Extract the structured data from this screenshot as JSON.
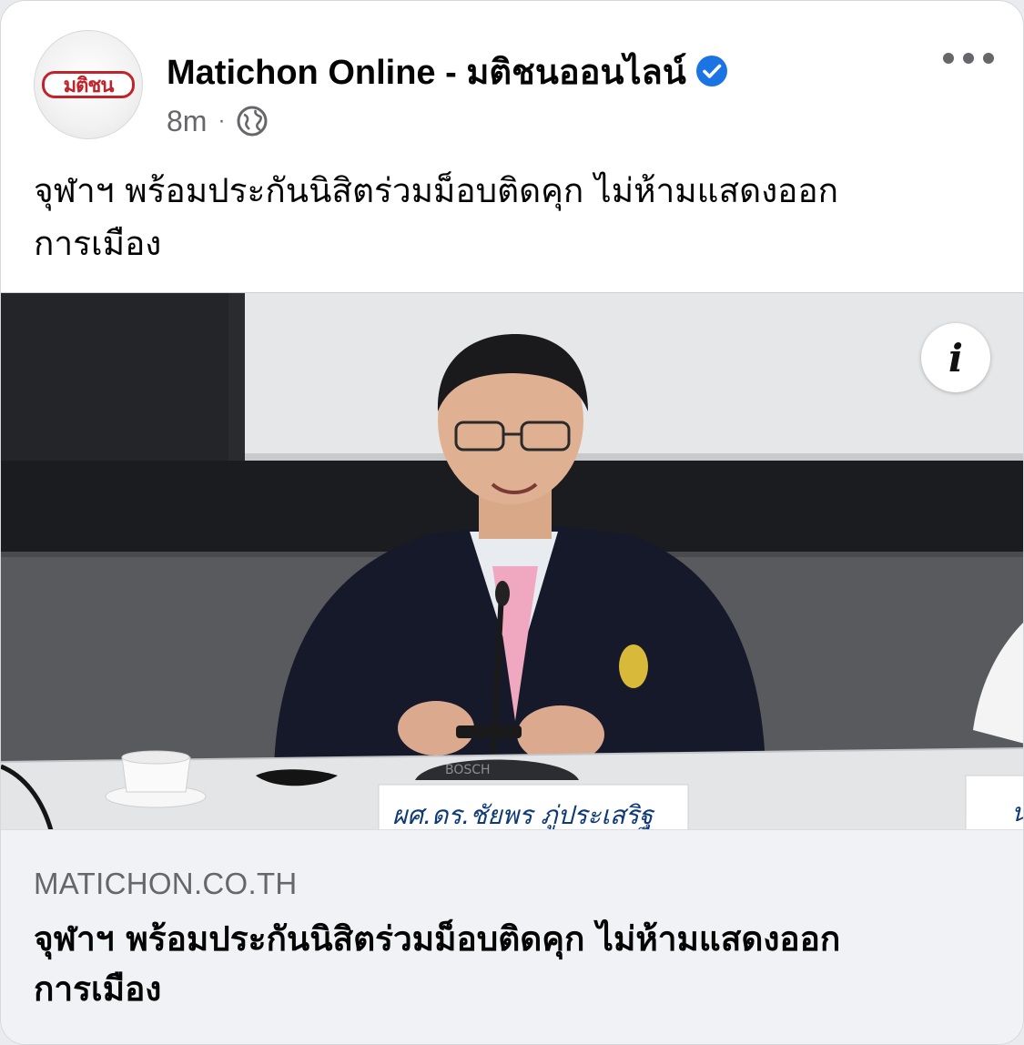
{
  "post": {
    "page_name": "Matichon Online - มติชนออนไลน์",
    "avatar_logo_text": "มติชน",
    "timestamp": "8m",
    "separator": "·",
    "privacy_icon": "globe-icon",
    "verified_icon": "verified-badge-icon",
    "more_icon": "more-options-icon",
    "text_line1": "จุฬาฯ พร้อมประกันนิสิตร่วมม็อบติดคุก ไม่ห้ามแสดงออก",
    "text_line2": "การเมือง"
  },
  "photo": {
    "info_label": "i",
    "mic_brand": "BOSCH",
    "nameplate": "ผศ.ดร.ชัยพร ภู่ประเสริฐ",
    "nameplate_partial": "น"
  },
  "link_preview": {
    "domain": "MATICHON.CO.TH",
    "title_line1": "จุฬาฯ พร้อมประกันนิสิตร่วมม็อบติดคุก ไม่ห้ามแสดงออก",
    "title_line2": "การเมือง"
  },
  "colors": {
    "verified_blue": "#1b74e4",
    "logo_red": "#c0242a",
    "text_primary": "#050505",
    "text_secondary": "#65676b",
    "footer_bg": "#f0f2f5"
  }
}
